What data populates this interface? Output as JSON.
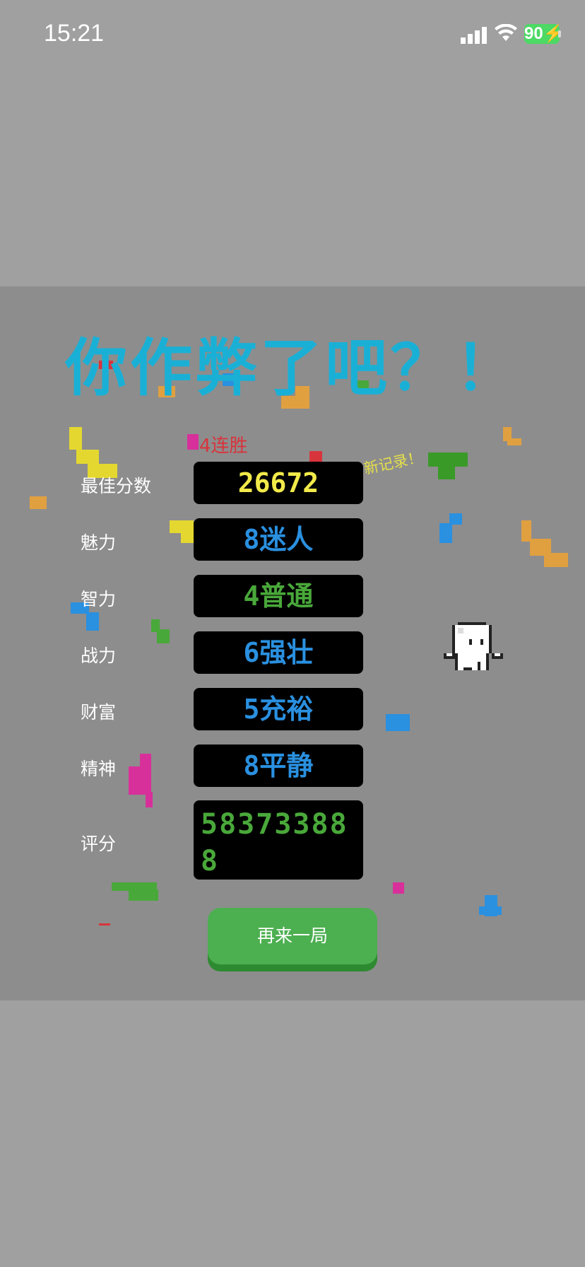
{
  "status": {
    "time": "15:21",
    "battery": "90"
  },
  "title": "你作弊了吧？！",
  "streak": "4连胜",
  "new_record": "新记录！",
  "rows": [
    {
      "label": "最佳分数",
      "value": "26672",
      "color": "#f2ea4a"
    },
    {
      "label": "魅力",
      "value": "8迷人",
      "color": "#2a90e0"
    },
    {
      "label": "智力",
      "value": "4普通",
      "color": "#49a83a"
    },
    {
      "label": "战力",
      "value": "6强壮",
      "color": "#2a90e0"
    },
    {
      "label": "财富",
      "value": "5充裕",
      "color": "#2a90e0"
    },
    {
      "label": "精神",
      "value": "8平静",
      "color": "#2a90e0"
    }
  ],
  "score": {
    "label": "评分",
    "value": "583733888"
  },
  "button": "再来一局",
  "colors": {
    "panel": "#8d8d8d",
    "title": "#1ab0d6",
    "button": "#4caf50"
  }
}
